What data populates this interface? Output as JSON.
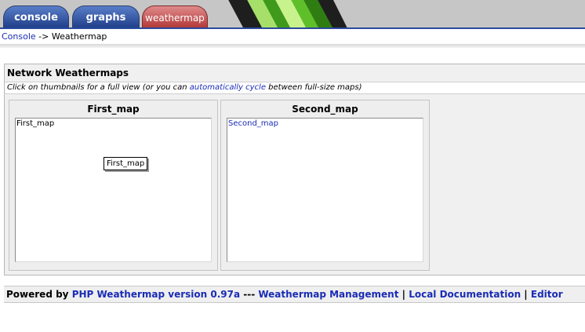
{
  "tabs": [
    {
      "label": "console"
    },
    {
      "label": "graphs"
    },
    {
      "label": "weathermap"
    }
  ],
  "breadcrumb": {
    "home": "Console",
    "separator": " -> ",
    "current": "Weathermap"
  },
  "panel": {
    "title": "Network Weathermaps",
    "subtitle_before": "Click on thumbnails for a full view (or you can ",
    "subtitle_link": "automatically cycle",
    "subtitle_after": " between full-size maps)"
  },
  "maps": [
    {
      "title": "First_map",
      "thumb_label": "First_map",
      "node_label": "First_map"
    },
    {
      "title": "Second_map",
      "thumb_label": "Second_map"
    }
  ],
  "footer": {
    "prefix": "Powered by ",
    "version_link": "PHP Weathermap version 0.97a",
    "sep1": " --- ",
    "management_link": "Weathermap Management",
    "sep2": " | ",
    "docs_link": "Local Documentation",
    "sep3": " | ",
    "editor_link": "Editor"
  },
  "colors": {
    "link": "#1a2cb5",
    "tab_blue": "#1d3b86",
    "tab_red": "#b03434",
    "accent_green": "#5fbf2a"
  }
}
